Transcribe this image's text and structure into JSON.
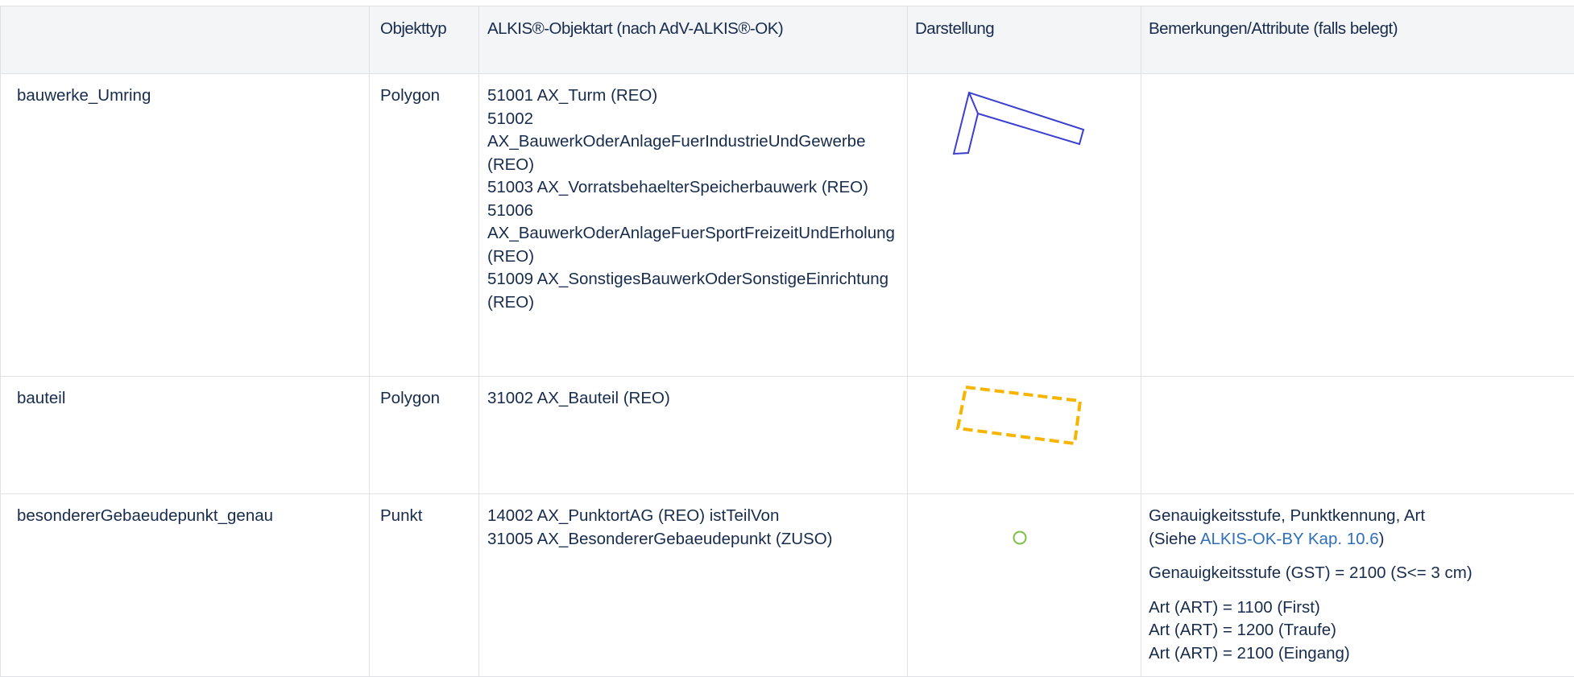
{
  "header": {
    "col1": "",
    "col2": "Objekttyp",
    "col3": "ALKIS®-Objektart (nach AdV-ALKIS®-OK)",
    "col4": "Darstellung",
    "col5": "Bemerkungen/Attribute (falls belegt)"
  },
  "rows": [
    {
      "name": "bauwerke_Umring",
      "type": "Polygon",
      "objektart": [
        "51001 AX_Turm (REO)",
        "51002 AX_BauwerkOderAnlageFuerIndustrieUndGewerbe (REO)",
        "51003 AX_VorratsbehaelterSpeicherbauwerk (REO)",
        "51006 AX_BauwerkOderAnlageFuerSportFreizeitUndErholung (REO)",
        "51009 AX_SonstigesBauwerkOderSonstigeEinrichtung (REO)"
      ],
      "symbol": "blue-outline-polygon",
      "color": "#3b3fd0"
    },
    {
      "name": "bauteil",
      "type": "Polygon",
      "objektart": [
        "31002 AX_Bauteil (REO)"
      ],
      "symbol": "yellow-dashed-polygon",
      "color": "#f7b500"
    },
    {
      "name": "besondererGebaeudepunkt_genau",
      "type": "Punkt",
      "objektart": [
        "14002 AX_PunktortAG (REO) istTeilVon",
        "31005 AX_BesondererGebaeudepunkt (ZUSO)"
      ],
      "symbol": "green-circle",
      "color": "#7ac143",
      "bemerkungen": {
        "line1": "Genauigkeitsstufe, Punktkennung, Art",
        "line2_prefix": "(Siehe ",
        "line2_link": "ALKIS-OK-BY Kap. 10.6",
        "line2_suffix": ")",
        "gst": "Genauigkeitsstufe (GST) = 2100 (S<= 3 cm)",
        "art1": "Art (ART) = 1100 (First)",
        "art2": "Art (ART) = 1200 (Traufe)",
        "art3": "Art (ART) = 2100 (Eingang)"
      }
    }
  ]
}
